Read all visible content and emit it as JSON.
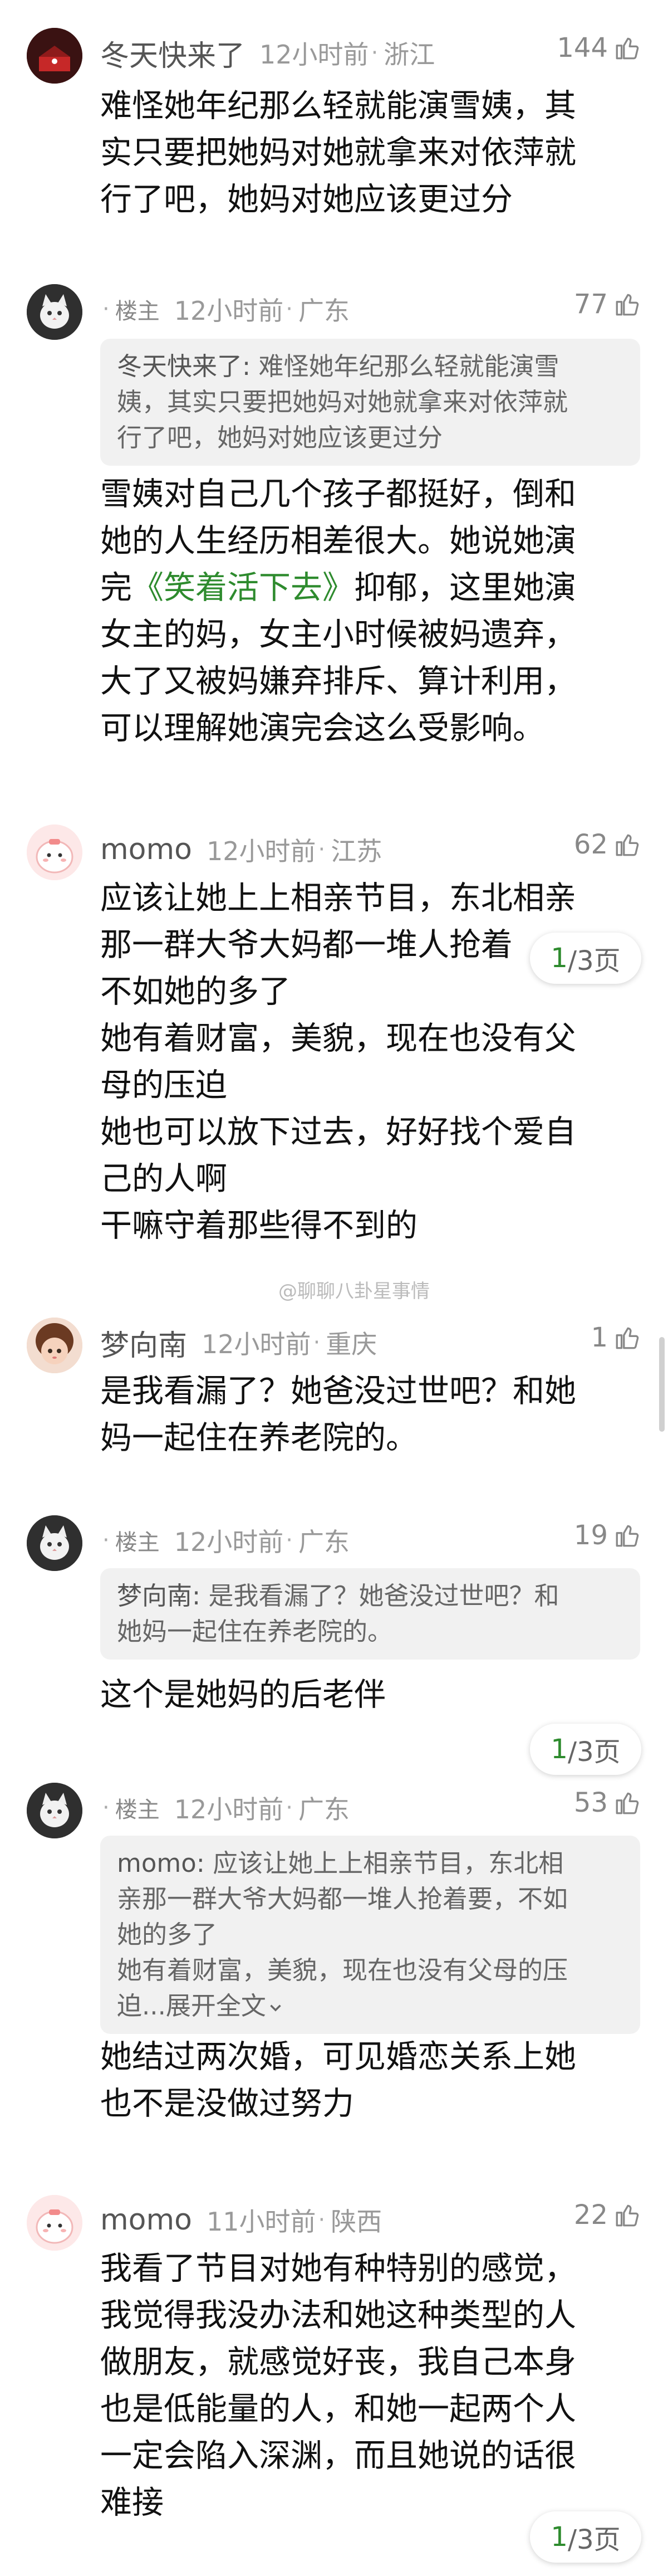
{
  "comments": [
    {
      "user": "冬天快来了",
      "time": "12小时前",
      "location": "浙江",
      "likes": "144",
      "text": "难怪她年纪那么轻就能演雪姨，其\n实只要把她妈对她就拿来对依萍就\n行了吧，她妈对她应该更过分"
    },
    {
      "op_badge": "楼主",
      "time": "12小时前",
      "location": "广东",
      "likes": "77",
      "quote_user": "冬天快来了:",
      "quote_text": " 难怪她年纪那么轻就能演雪\n姨，其实只要把她妈对她就拿来对依萍就\n行了吧，她妈对她应该更过分",
      "text_a": "雪姨对自己几个孩子都挺好，倒和\n她的人生经历相差很大。她说她演\n完",
      "text_link": "《笑着活下去》",
      "text_b": "抑郁，这里她演\n女主的妈，女主小时候被妈遗弃，\n大了又被妈嫌弃排斥、算计利用，\n可以理解她演完会这么受影响。"
    },
    {
      "user": "momo",
      "time": "12小时前",
      "location": "江苏",
      "likes": "62",
      "text": "应该让她上上相亲节目，东北相亲\n那一群大爷大妈都一堆人抢着\n不如她的多了\n她有着财富，美貌，现在也没有父\n母的压迫\n她也可以放下过去，好好找个爱自\n己的人啊\n干嘛守着那些得不到的"
    },
    {
      "user": "梦向南",
      "time": "12小时前",
      "location": "重庆",
      "likes": "1",
      "text": "是我看漏了？她爸没过世吧？和她\n妈一起住在养老院的。"
    },
    {
      "op_badge": "楼主",
      "time": "12小时前",
      "location": "广东",
      "likes": "19",
      "quote_user": "梦向南:",
      "quote_text": " 是我看漏了？她爸没过世吧？和\n她妈一起住在养老院的。",
      "text": "这个是她妈的后老伴"
    },
    {
      "op_badge": "楼主",
      "time": "12小时前",
      "location": "广东",
      "likes": "53",
      "quote_user": "momo:",
      "quote_text": " 应该让她上上相亲节目，东北相\n亲那一群大爷大妈都一堆人抢着要，不如\n她的多了\n她有着财富，美貌，现在也没有父母的压\n迫...展开全文",
      "text": "她结过两次婚，可见婚恋关系上她\n也不是没做过努力"
    },
    {
      "user": "momo",
      "time": "11小时前",
      "location": "陕西",
      "likes": "22",
      "text": "我看了节目对她有种特别的感觉，\n我觉得我没办法和她这种类型的人\n做朋友，就感觉好丧，我自己本身\n也是低能量的人，和她一起两个人\n一定会陷入深渊，而且她说的话很\n难接"
    }
  ],
  "pager": {
    "current": "1",
    "total": "/3页"
  },
  "watermark": "@聊聊八卦星事情",
  "colors": {
    "accent_green": "#2e8b2e",
    "quote_bg": "#f1f1f1"
  }
}
